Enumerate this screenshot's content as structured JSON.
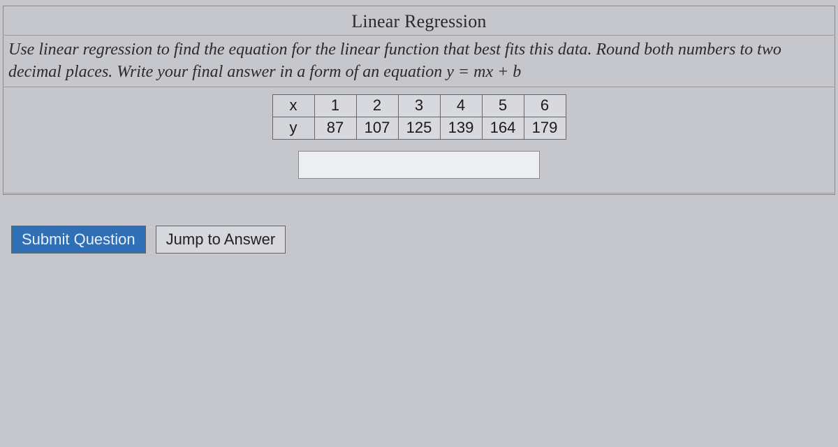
{
  "title": "Linear Regression",
  "instruction_pre": "Use linear regression to find the equation for the linear function that best fits this data. Round both numbers to two decimal places. Write your final answer in a form of an equation ",
  "equation": "y = mx + b",
  "data_table": {
    "row_x_label": "x",
    "row_y_label": "y",
    "x": [
      "1",
      "2",
      "3",
      "4",
      "5",
      "6"
    ],
    "y": [
      "87",
      "107",
      "125",
      "139",
      "164",
      "179"
    ]
  },
  "answer_value": "",
  "buttons": {
    "submit": "Submit Question",
    "jump": "Jump to Answer"
  },
  "chart_data": {
    "type": "table",
    "title": "Linear Regression data",
    "categories": [
      1,
      2,
      3,
      4,
      5,
      6
    ],
    "values": [
      87,
      107,
      125,
      139,
      164,
      179
    ],
    "xlabel": "x",
    "ylabel": "y"
  }
}
